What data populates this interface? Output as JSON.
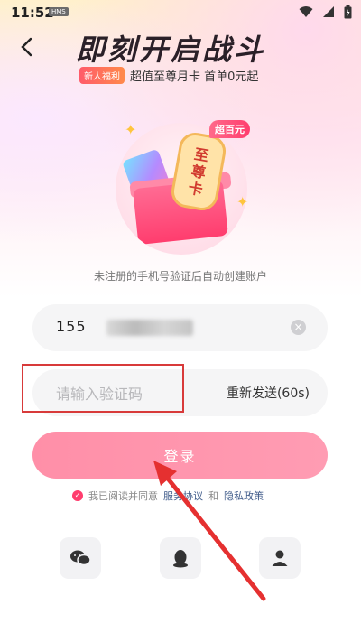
{
  "status_bar": {
    "time": "11:52",
    "badge": "HMS"
  },
  "header": {
    "title": "即刻开启战斗",
    "newbie_badge": "新人福利",
    "subtitle": "超值至尊月卡 首单0元起"
  },
  "hero": {
    "chip": "超百元",
    "scroll_text": [
      "至",
      "尊",
      "卡"
    ]
  },
  "hint": "未注册的手机号验证后自动创建账户",
  "phone": {
    "value_prefix": "155",
    "value_suffix": ""
  },
  "code": {
    "placeholder": "请输入验证码",
    "resend_label": "重新发送(60s)"
  },
  "login_button": "登录",
  "agreement": {
    "prefix": "我已阅读并同意",
    "service_link": "服务协议",
    "and": "和",
    "privacy_link": "隐私政策"
  },
  "social": [
    "wechat-icon",
    "qq-icon",
    "user-icon"
  ],
  "colors": {
    "accent": "#ff3d6e",
    "login_bg": "#ff9cb3",
    "annotation": "#d83a3a"
  }
}
